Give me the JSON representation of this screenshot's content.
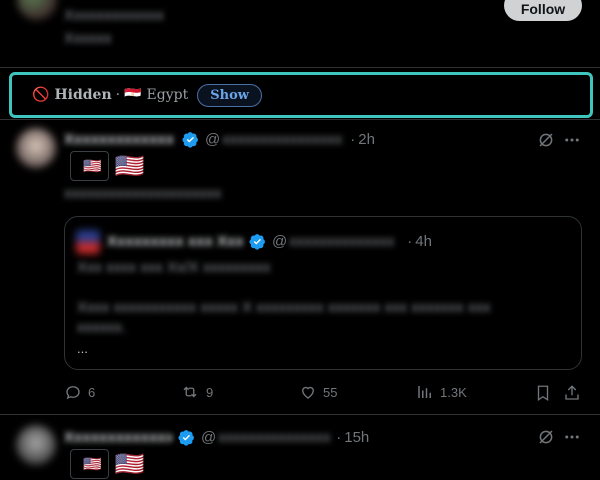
{
  "top_post": {
    "follow_label": "Follow",
    "name_blurred": "Xxxxxxxxxxxxx",
    "line_blurred": "Xxxxxx"
  },
  "hidden_banner": {
    "hidden_icon": "🚫",
    "hidden_label": "Hidden",
    "separator": "·",
    "flag": "🇪🇬",
    "country": "Egypt",
    "show_label": "Show",
    "accent": "#40c4be"
  },
  "post1": {
    "name_blurred": "Xxxxxxxxxxxxx",
    "handle_prefix": "@",
    "handle_blurred": "xxxxxxxxxxxxxxxx",
    "dot": "·",
    "time": "2h",
    "badge_apple": "",
    "badge_flag_small": "🇺🇸",
    "badge_flag_large": "🇺🇸",
    "text_blurred": "xxxxxxxxxxxxxxxxxxxxx",
    "quote": {
      "name_blurred": "Xxxxxxxxx xxx Xxxx",
      "handle_prefix": "@",
      "handle_blurred": "xxxxxxxxxxxxxx",
      "dot": "·",
      "time": "4h",
      "line1_blurred": "Xxx xxxx xxx Xx/X xxxxxxxxx",
      "line2_blurred": "Xxxx xxxxxxxxxxx xxxxx X xxxxxxxxx xxxxxxx xxx xxxxxxx xxx",
      "line3_blurred": "xxxxxx.",
      "ellipsis": "..."
    },
    "replies": "6",
    "reposts": "9",
    "likes": "55",
    "views": "1.3K"
  },
  "post2": {
    "name_blurred": "Xxxxxxxxxxxxx",
    "handle_prefix": "@",
    "handle_blurred": "xxxxxxxxxxxxxxx",
    "dot": "·",
    "time": "15h",
    "badge_apple": "",
    "badge_flag_small": "🇺🇸",
    "badge_flag_large": "🇺🇸"
  },
  "colors": {
    "verified": "#1d9bf0",
    "border": "#2f3336"
  }
}
